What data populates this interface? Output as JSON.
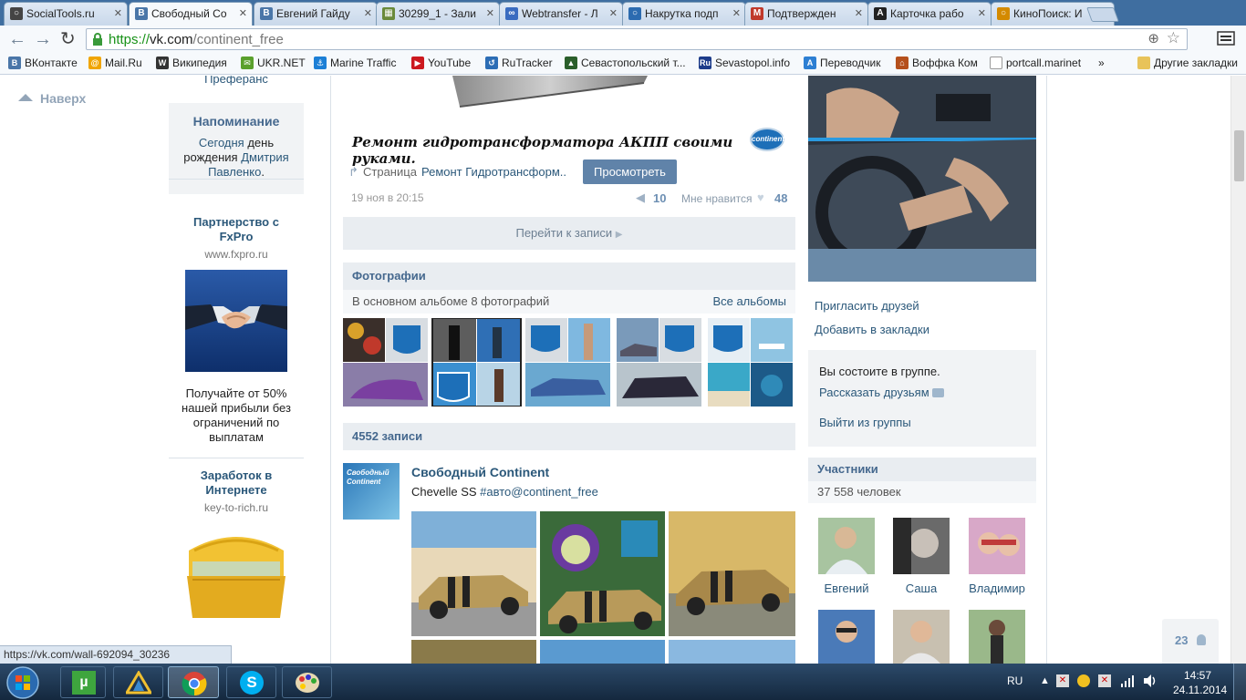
{
  "browser": {
    "tabs": [
      {
        "label": "SocialTools.ru",
        "color": "#444"
      },
      {
        "label": "Свободный Со",
        "color": "#4a76a8"
      },
      {
        "label": "Евгений Гайду",
        "color": "#4a76a8"
      },
      {
        "label": "30299_1 - Зали",
        "color": "#6a8a3a"
      },
      {
        "label": "Webtransfer - Л",
        "color": "#3a6cc0"
      },
      {
        "label": "Накрутка подп",
        "color": "#2c6bb0"
      },
      {
        "label": "Подтвержден",
        "color": "#c0392b"
      },
      {
        "label": "Карточка рабо",
        "color": "#222"
      },
      {
        "label": "КиноПоиск: И",
        "color": "#d48a00"
      }
    ],
    "url_scheme": "https://",
    "url_host": "vk.com",
    "url_path": "/continent_free",
    "bookmarks": [
      {
        "label": "ВКонтакте",
        "color": "#4a76a8"
      },
      {
        "label": "Mail.Ru",
        "color": "#f0a500"
      },
      {
        "label": "Википедия",
        "color": "#333"
      },
      {
        "label": "UKR.NET",
        "color": "#5aa02c"
      },
      {
        "label": "Marine Traffic",
        "color": "#1c7fd6"
      },
      {
        "label": "YouTube",
        "color": "#cc181e"
      },
      {
        "label": "RuTracker",
        "color": "#2c6db5"
      },
      {
        "label": "Севастопольский т...",
        "color": "#2a5e2a"
      },
      {
        "label": "Sevastopol.info",
        "color": "#1d3c8a"
      },
      {
        "label": "Переводчик",
        "color": "#2d7fd3"
      },
      {
        "label": "Воффка Ком",
        "color": "#b5501c"
      },
      {
        "label": "portcall.marinet",
        "color": "#777"
      }
    ],
    "bookmarks_more": "»",
    "other_bookmarks": "Другие закладки"
  },
  "page": {
    "up_label": "Наверх",
    "left": {
      "cut_text": "Преферанс",
      "reminder_title": "Напоминание",
      "reminder_today": "Сегодня",
      "reminder_mid": " день рождения ",
      "reminder_name": "Дмитрия Павленко",
      "reminder_end": ".",
      "ad1_title": "Партнерство с FxPro",
      "ad1_domain": "www.fxpro.ru",
      "ad1_text": "Получайте от 50% нашей прибыли без ограничений по выплатам",
      "ad2_title": "Заработок в Интернете",
      "ad2_domain": "key-to-rich.ru"
    },
    "post": {
      "caption": "Ремонт гидротрансформатора АКПП своими руками.",
      "logo_text": "continent",
      "page_prefix": "Страница",
      "page_link": "Ремонт Гидротрансформ..",
      "view_button": "Просмотреть",
      "date": "19 ноя в 20:15",
      "reposts": "10",
      "like_label": "Мне нравится",
      "likes": "48",
      "goto_label": "Перейти к записи"
    },
    "photos": {
      "header": "Фотографии",
      "subtitle": "В основном альбоме 8 фотографий",
      "all_albums": "Все альбомы"
    },
    "wall": {
      "count_header": "4552 записи",
      "author": "Свободный Continent",
      "text_plain": "Chevelle SS ",
      "hashtag": "#авто@continent_free",
      "avatar_text": "Свободный Continent"
    },
    "right": {
      "invite": "Пригласить друзей",
      "bookmark": "Добавить в закладки",
      "member_status": "Вы состоите в группе.",
      "tell_friends": "Рассказать друзьям",
      "leave_group": "Выйти из группы",
      "members_header": "Участники",
      "members_count": "37 558 человек",
      "members": [
        "Евгений",
        "Саша",
        "Владимир"
      ]
    },
    "status_url": "https://vk.com/wall-692094_30236",
    "online_count": "23"
  },
  "taskbar": {
    "lang": "RU",
    "time": "14:57",
    "date": "24.11.2014"
  },
  "colors": {
    "vk_link": "#2b587a",
    "vk_header": "#45688e",
    "vk_button": "#6083a9",
    "url_green": "#189218"
  }
}
